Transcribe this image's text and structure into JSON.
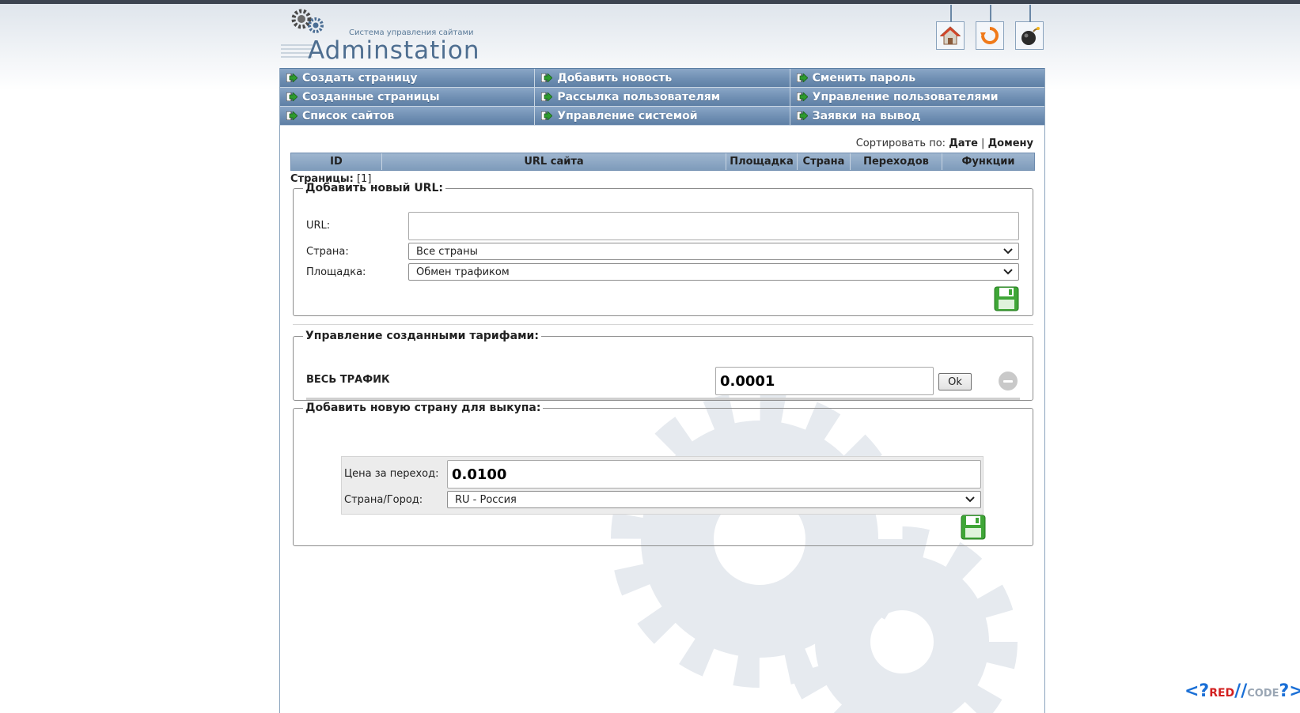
{
  "header": {
    "logo_tagline": "Система управления сайтами",
    "logo_name": "Adminstation",
    "icons": [
      "home-icon",
      "refresh-icon",
      "bomb-icon"
    ]
  },
  "nav": {
    "row1": [
      "Создать страницу",
      "Добавить новость",
      "Сменить пароль"
    ],
    "row2": [
      "Созданные страницы",
      "Рассылка пользователям",
      "Управление пользователями"
    ],
    "row3": [
      "Список сайтов",
      "Управление системой",
      "Заявки на вывод"
    ]
  },
  "sort": {
    "label": "Сортировать по:",
    "by_date": "Дате",
    "separator": "|",
    "by_domain": "Домену"
  },
  "table": {
    "columns": [
      "ID",
      "URL сайта",
      "Площадка",
      "Страна",
      "Переходов",
      "Функции"
    ]
  },
  "pagination": {
    "label": "Страницы:",
    "pages": "[1]"
  },
  "add_url": {
    "legend": "Добавить новый URL:",
    "url_label": "URL:",
    "url_value": "",
    "country_label": "Страна:",
    "country_value": "Все страны",
    "site_label": "Площадка:",
    "site_value": "Обмен трафиком"
  },
  "tariffs": {
    "legend": "Управление созданными тарифами:",
    "row_name": "ВЕСЬ ТРАФИК",
    "row_value": "0.0001",
    "ok_label": "Ok"
  },
  "add_country": {
    "legend": "Добавить новую страну для выкупа:",
    "price_label": "Цена за переход:",
    "price_value": "0.0100",
    "country_label": "Страна/Город:",
    "country_value": "RU - Россия"
  },
  "watermark": {
    "left": "<?",
    "brand": "RED",
    "slashes": "//",
    "code": "CODE",
    "right": "?>"
  },
  "colors": {
    "nav_bg": "#6f8fb3",
    "border": "#8aa3bd",
    "save_green": "#3fa637"
  }
}
